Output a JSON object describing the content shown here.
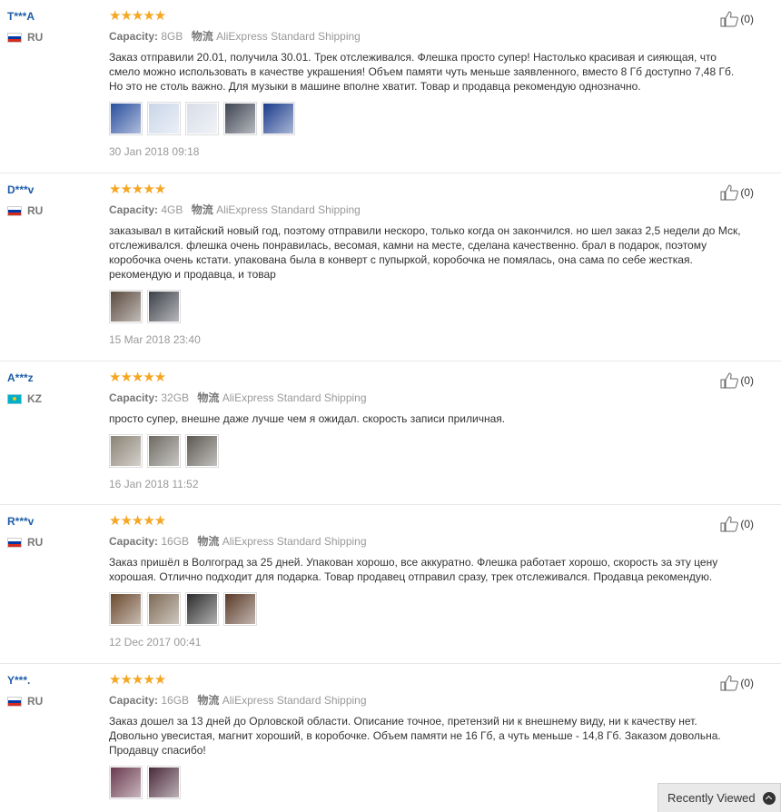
{
  "ui": {
    "capacity_label": "Capacity:",
    "shipping_label": "物流",
    "stars": "★★★★★",
    "recently_viewed": "Recently Viewed"
  },
  "reviews": [
    {
      "user": "T***A",
      "country": "RU",
      "flag": "ru",
      "capacity": "8GB",
      "shipping": "AliExpress Standard Shipping",
      "text": "Заказ отправили 20.01, получила 30.01. Трек отслеживался. Флешка просто супер! Настолько красивая и сияющая, что смело можно использовать в качестве украшения! Объем памяти чуть меньше заявленного, вместо 8 Гб доступно 7,48 Гб. Но это не столь важно. Для музыки в машине вполне хватит. Товар и продавца рекомендую однозначно.",
      "photos": [
        "#2a4f9e",
        "#c9d6e8",
        "#d8dde8",
        "#3e4452",
        "#1a3b8c"
      ],
      "date": "30 Jan 2018 09:18",
      "likes": "(0)"
    },
    {
      "user": "D***v",
      "country": "RU",
      "flag": "ru",
      "capacity": "4GB",
      "shipping": "AliExpress Standard Shipping",
      "text": "заказывал в китайский новый год, поэтому отправили нескоро, только когда он закончился. но шел заказ 2,5 недели до Мск, отслеживался. флешка очень понравилась, весомая, камни на месте, сделана качественно. брал в подарок, поэтому коробочка очень кстати. упакована была в конверт с пупыркой, коробочка не помялась, она сама по себе жесткая. рекомендую и продавца, и товар",
      "photos": [
        "#5a4a3e",
        "#3c4048"
      ],
      "date": "15 Mar 2018 23:40",
      "likes": "(0)"
    },
    {
      "user": "A***z",
      "country": "KZ",
      "flag": "kz",
      "capacity": "32GB",
      "shipping": "AliExpress Standard Shipping",
      "text": "просто супер, внешне даже лучше чем я ожидал. скорость записи приличная.",
      "photos": [
        "#8a8275",
        "#6e6a62",
        "#5c5850"
      ],
      "date": "16 Jan 2018 11:52",
      "likes": "(0)"
    },
    {
      "user": "R***v",
      "country": "RU",
      "flag": "ru",
      "capacity": "16GB",
      "shipping": "AliExpress Standard Shipping",
      "text": "Заказ пришёл в Волгоград за 25 дней. Упакован хорошо, все аккуратно. Флешка работает хорошо, скорость за эту цену хорошая. Отлично подходит для подарка. Товар продавец отправил сразу, трек отслеживался. Продавца рекомендую.",
      "photos": [
        "#6b4a2e",
        "#7e6a55",
        "#2c2c2c",
        "#5a3a28"
      ],
      "date": "12 Dec 2017 00:41",
      "likes": "(0)"
    },
    {
      "user": "Y***.",
      "country": "RU",
      "flag": "ru",
      "capacity": "16GB",
      "shipping": "AliExpress Standard Shipping",
      "text": "Заказ дошел за 13 дней до Орловской области. Описание точное, претензий ни к внешнему виду, ни к качеству нет. Довольно увесистая, магнит хороший, в коробочке. Объем памяти не 16 Гб, а чуть меньше - 14,8 Гб. Заказом довольна. Продавцу спасибо!",
      "photos": [
        "#6a3a4e",
        "#4a2a3a"
      ],
      "date": "",
      "likes": "(0)"
    }
  ]
}
